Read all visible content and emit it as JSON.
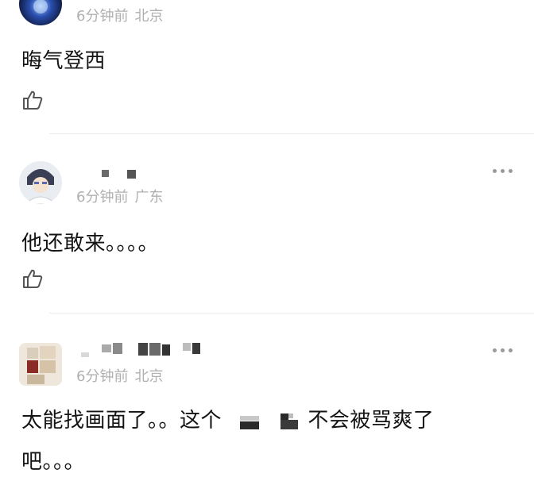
{
  "comments": [
    {
      "time": "6分钟前",
      "location": "北京",
      "text": "晦气登西"
    },
    {
      "time": "6分钟前",
      "location": "广东",
      "text": "他还敢来。。。。"
    },
    {
      "time": "6分钟前",
      "location": "北京",
      "text_line1_part1": "太能找画面了。。这个",
      "text_line1_part2": "不会被骂爽了",
      "text_line2": "吧。。。"
    }
  ],
  "icons": {
    "like": "thumbs-up-icon",
    "more": "more-dots-icon"
  },
  "colors": {
    "meta_text": "#b0b0b0",
    "body_text": "#141414",
    "divider": "#ececec"
  }
}
